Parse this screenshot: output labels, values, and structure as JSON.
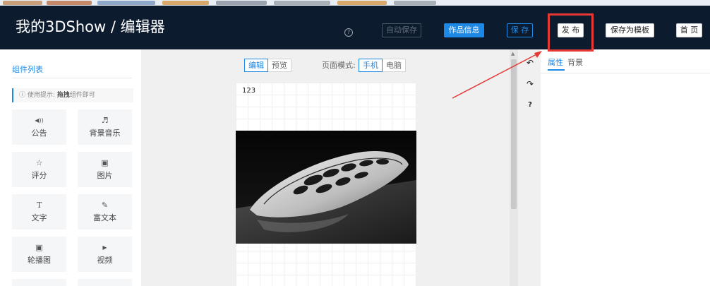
{
  "header": {
    "title": "我的3DShow / 编辑器",
    "help_glyph": "?",
    "autosave": "自动保存",
    "work_info": "作品信息",
    "save": "保 存",
    "publish": "发 布",
    "save_template": "保存为模板",
    "home": "首 页"
  },
  "components": {
    "title": "组件列表",
    "tip_prefix": "ⓘ 使用提示: ",
    "tip_bold": "拖拽",
    "tip_suffix": "组件即可",
    "items": [
      {
        "icon": "◀))",
        "label": "公告",
        "icon_name": "volume-icon"
      },
      {
        "icon": "♬",
        "label": "背景音乐",
        "icon_name": "music-icon"
      },
      {
        "icon": "☆",
        "label": "评分",
        "icon_name": "star-icon"
      },
      {
        "icon": "▣",
        "label": "图片",
        "icon_name": "image-icon"
      },
      {
        "icon": "T",
        "label": "文字",
        "icon_name": "text-icon"
      },
      {
        "icon": "✎",
        "label": "富文本",
        "icon_name": "edit-icon"
      },
      {
        "icon": "▣",
        "label": "轮播图",
        "icon_name": "carousel-icon"
      },
      {
        "icon": "▶",
        "label": "视频",
        "icon_name": "video-icon"
      }
    ]
  },
  "canvas": {
    "edit": "编辑",
    "preview": "预览",
    "mode_label": "页面模式:",
    "mobile": "手机",
    "desktop": "电脑",
    "text_block": "123"
  },
  "tools": {
    "undo": "↶",
    "redo": "↷",
    "help": "?"
  },
  "props": {
    "tab_attr": "属性",
    "tab_bg": "背景"
  },
  "colors": {
    "header_bg": "#0d1b2e",
    "accent": "#1e88e5",
    "highlight": "#e53935"
  }
}
